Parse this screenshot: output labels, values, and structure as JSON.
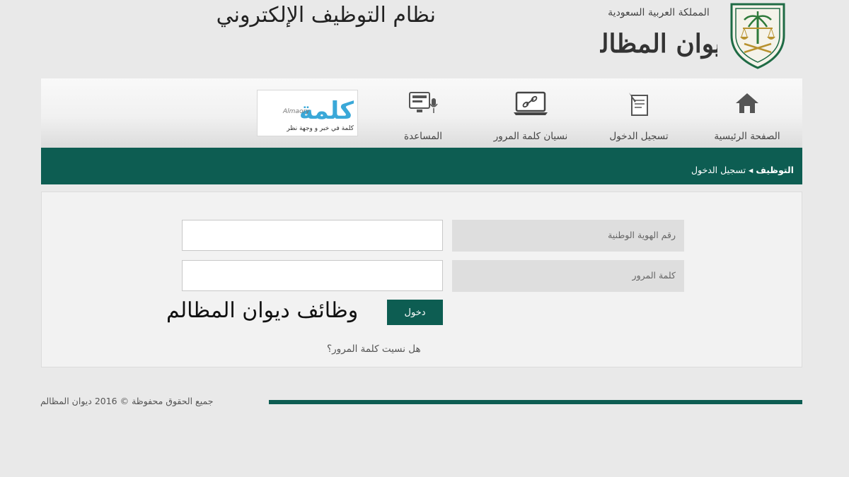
{
  "header": {
    "system_title": "نظام التوظيف الإلكتروني",
    "logo_wordmark_text": "ديوان المظالم",
    "logo_subtitle_text": "المملكة العربية السعودية"
  },
  "nav": {
    "items": [
      {
        "label": "الصفحة الرئيسية",
        "icon": "home-icon"
      },
      {
        "label": "تسجيل الدخول",
        "icon": "login-document-icon"
      },
      {
        "label": "نسيان كلمة المرور",
        "icon": "laptop-link-icon"
      },
      {
        "label": "المساعدة",
        "icon": "help-monitor-microphone-icon"
      }
    ],
    "ad": {
      "brand": "كلمة",
      "latin": "Almaory",
      "tagline": "كلمة في خبر و وجهة نظر"
    }
  },
  "breadcrumb": {
    "root": "التوظيف",
    "separator": "◂",
    "current": "تسجيل الدخول"
  },
  "form": {
    "national_id_label": "رقم الهوية الوطنية",
    "national_id_value": "",
    "password_label": "كلمة المرور",
    "password_value": "",
    "login_button": "دخول",
    "forgot_password": "هل نسيت كلمة المرور؟"
  },
  "overlay_caption": "وظائف ديوان المظالم",
  "footer": {
    "copyright": "جميع الحقوق محفوظة © 2016 ديوان المظالم"
  },
  "colors": {
    "primary_green": "#0d5d52",
    "background": "#e9e9e9",
    "ad_blue": "#3aa8d8"
  }
}
